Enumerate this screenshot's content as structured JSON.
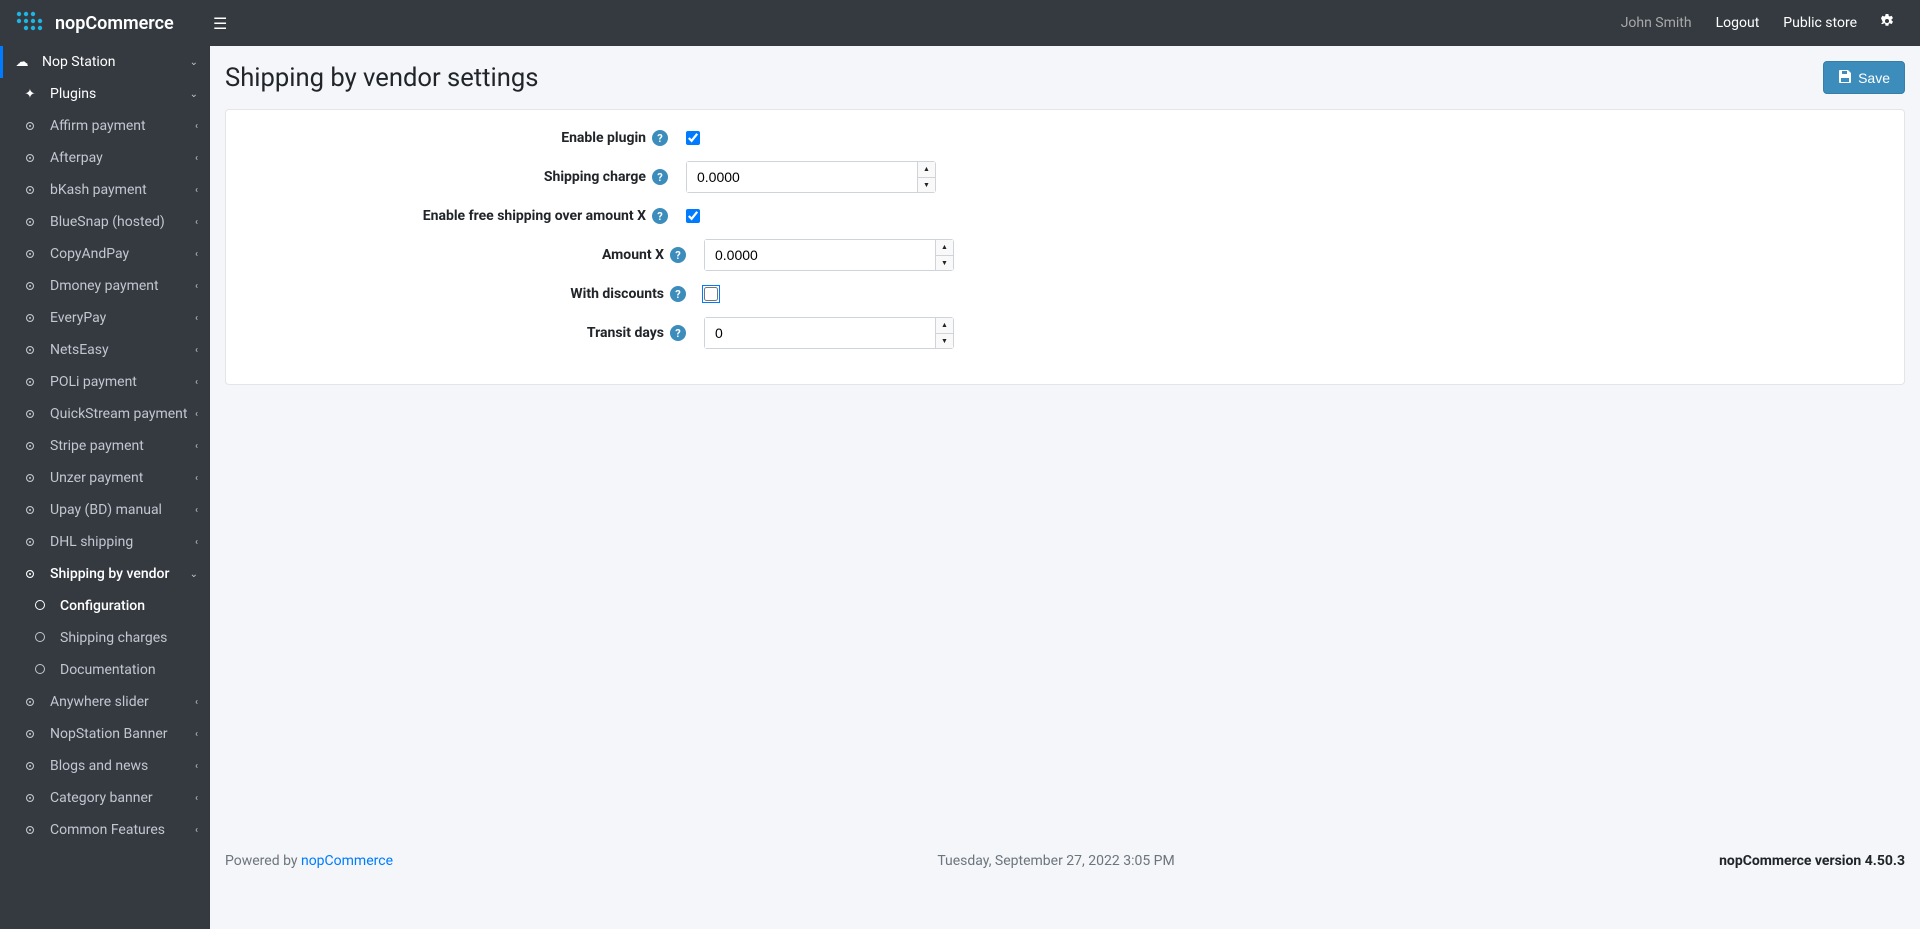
{
  "header": {
    "brand": "nopCommerce",
    "user": "John Smith",
    "logout": "Logout",
    "public_store": "Public store"
  },
  "sidebar": {
    "top_item": "Nop Station",
    "plugins_label": "Plugins",
    "plugin_items": [
      "Affirm payment",
      "Afterpay",
      "bKash payment",
      "BlueSnap (hosted)",
      "CopyAndPay",
      "Dmoney payment",
      "EveryPay",
      "NetsEasy",
      "POLi payment",
      "QuickStream payment",
      "Stripe payment",
      "Unzer payment",
      "Upay (BD) manual",
      "DHL shipping"
    ],
    "current_plugin": "Shipping by vendor",
    "current_sub_items": [
      "Configuration",
      "Shipping charges",
      "Documentation"
    ],
    "after_items": [
      "Anywhere slider",
      "NopStation Banner",
      "Blogs and news",
      "Category banner",
      "Common Features"
    ]
  },
  "page": {
    "title": "Shipping by vendor settings",
    "save_label": "Save"
  },
  "form": {
    "enable_plugin": {
      "label": "Enable plugin",
      "value": true
    },
    "shipping_charge": {
      "label": "Shipping charge",
      "value": "0.0000"
    },
    "enable_free_shipping": {
      "label": "Enable free shipping over amount X",
      "value": true
    },
    "amount_x": {
      "label": "Amount X",
      "value": "0.0000"
    },
    "with_discounts": {
      "label": "With discounts",
      "value": false
    },
    "transit_days": {
      "label": "Transit days",
      "value": "0"
    }
  },
  "footer": {
    "powered_by": "Powered by ",
    "powered_link": "nopCommerce",
    "datetime": "Tuesday, September 27, 2022 3:05 PM",
    "version": "nopCommerce version 4.50.3"
  }
}
